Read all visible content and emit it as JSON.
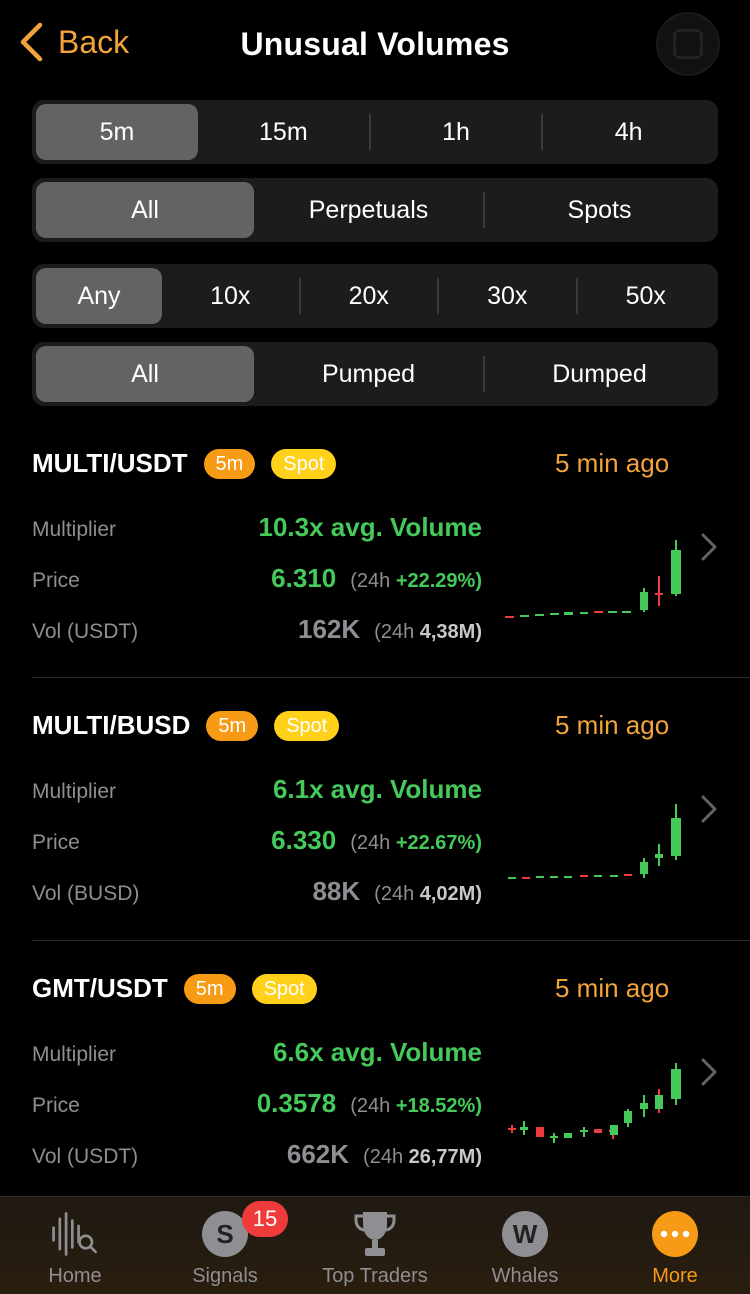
{
  "header": {
    "back_label": "Back",
    "title": "Unusual Volumes"
  },
  "filters": {
    "timeframes": [
      "5m",
      "15m",
      "1h",
      "4h"
    ],
    "markets": [
      "All",
      "Perpetuals",
      "Spots"
    ],
    "multipliers": [
      "Any",
      "10x",
      "20x",
      "30x",
      "50x"
    ],
    "directions": [
      "All",
      "Pumped",
      "Dumped"
    ]
  },
  "labels": {
    "multiplier": "Multiplier",
    "price": "Price"
  },
  "cards": [
    {
      "pair": "MULTI/USDT",
      "timeframe": "5m",
      "market": "Spot",
      "ago": "5 min ago",
      "multiplier": "10.3x avg. Volume",
      "price": "6.310",
      "price_24h_prefix": "(24h",
      "price_24h_change": "+22.29%)",
      "vol_label": "Vol (USDT)",
      "vol": "162K",
      "vol_24h_prefix": "(24h",
      "vol_24h": "4,38M)"
    },
    {
      "pair": "MULTI/BUSD",
      "timeframe": "5m",
      "market": "Spot",
      "ago": "5 min ago",
      "multiplier": "6.1x avg. Volume",
      "price": "6.330",
      "price_24h_prefix": "(24h",
      "price_24h_change": "+22.67%)",
      "vol_label": "Vol (BUSD)",
      "vol": "88K",
      "vol_24h_prefix": "(24h",
      "vol_24h": "4,02M)"
    },
    {
      "pair": "GMT/USDT",
      "timeframe": "5m",
      "market": "Spot",
      "ago": "5 min ago",
      "multiplier": "6.6x avg. Volume",
      "price": "0.3578",
      "price_24h_prefix": "(24h",
      "price_24h_change": "+18.52%)",
      "vol_label": "Vol (USDT)",
      "vol": "662K",
      "vol_24h_prefix": "(24h",
      "vol_24h": "26,77M)"
    }
  ],
  "tabbar": {
    "home": "Home",
    "signals": "Signals",
    "signals_badge": "15",
    "signals_letter": "S",
    "top_traders": "Top Traders",
    "whales": "Whales",
    "whales_letter": "W",
    "more": "More"
  },
  "colors": {
    "accent": "#f79a16",
    "up": "#45c95a",
    "down": "#ef3b3b",
    "spot_badge": "#ffd11a",
    "active_segment": "#636366",
    "segment_bg": "#1c1c1e"
  },
  "icons": [
    "chevron-left-icon",
    "chart-grid-icon",
    "chevron-right-icon",
    "home-waveform-search-icon",
    "trophy-icon",
    "more-dots-icon"
  ]
}
